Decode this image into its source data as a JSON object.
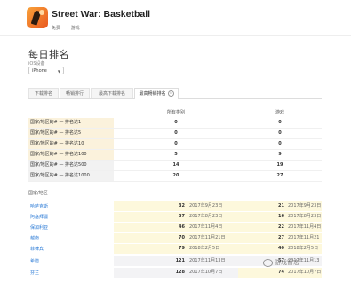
{
  "app": {
    "title": "Street War: Basketball",
    "price": "免费",
    "category": "游戏"
  },
  "page": {
    "title": "每日排名",
    "device_label": "iOS设备",
    "device_value": "iPhone"
  },
  "tabs": [
    {
      "label": "下载排名"
    },
    {
      "label": "畅销排行"
    },
    {
      "label": "最高下载排名"
    },
    {
      "label": "最高畅销排名"
    }
  ],
  "summary": {
    "headers": {
      "all": "所有类别",
      "game": "游戏"
    },
    "rows": [
      {
        "label": "国家/地区的# — 排名达1",
        "all": "0",
        "game": "0"
      },
      {
        "label": "国家/地区的# — 排名达5",
        "all": "0",
        "game": "0"
      },
      {
        "label": "国家/地区的# — 排名达10",
        "all": "0",
        "game": "0"
      },
      {
        "label": "国家/地区的# — 排名达100",
        "all": "5",
        "game": "9"
      },
      {
        "label": "国家/地区的# — 排名达500",
        "all": "14",
        "game": "19"
      },
      {
        "label": "国家/地区的# — 排名达1000",
        "all": "20",
        "game": "27"
      }
    ]
  },
  "countries": {
    "label": "国家/地区",
    "rows": [
      {
        "name": "哈萨克斯",
        "all_rank": "32",
        "all_date": "2017年9月23日",
        "game_rank": "21",
        "game_date": "2017年9月23日"
      },
      {
        "name": "阿塞拜疆",
        "all_rank": "37",
        "all_date": "2017年8月23日",
        "game_rank": "16",
        "game_date": "2017年8月23日"
      },
      {
        "name": "保加利亚",
        "all_rank": "46",
        "all_date": "2017年11月4日",
        "game_rank": "22",
        "game_date": "2017年11月4日"
      },
      {
        "name": "越南",
        "all_rank": "70",
        "all_date": "2017年11月21日",
        "game_rank": "27",
        "game_date": "2017年11月21日"
      },
      {
        "name": "菲律宾",
        "all_rank": "79",
        "all_date": "2018年2月5日",
        "game_rank": "40",
        "game_date": "2018年2月5日"
      },
      {
        "name": "希腊",
        "all_rank": "121",
        "all_date": "2017年11月13日",
        "game_rank": "57",
        "game_date": "2017年11月13日"
      },
      {
        "name": "芬兰",
        "all_rank": "128",
        "all_date": "2017年10月7日",
        "game_rank": "74",
        "game_date": "2017年10月7日"
      }
    ]
  },
  "watermark": {
    "text": "游戏智宏"
  }
}
